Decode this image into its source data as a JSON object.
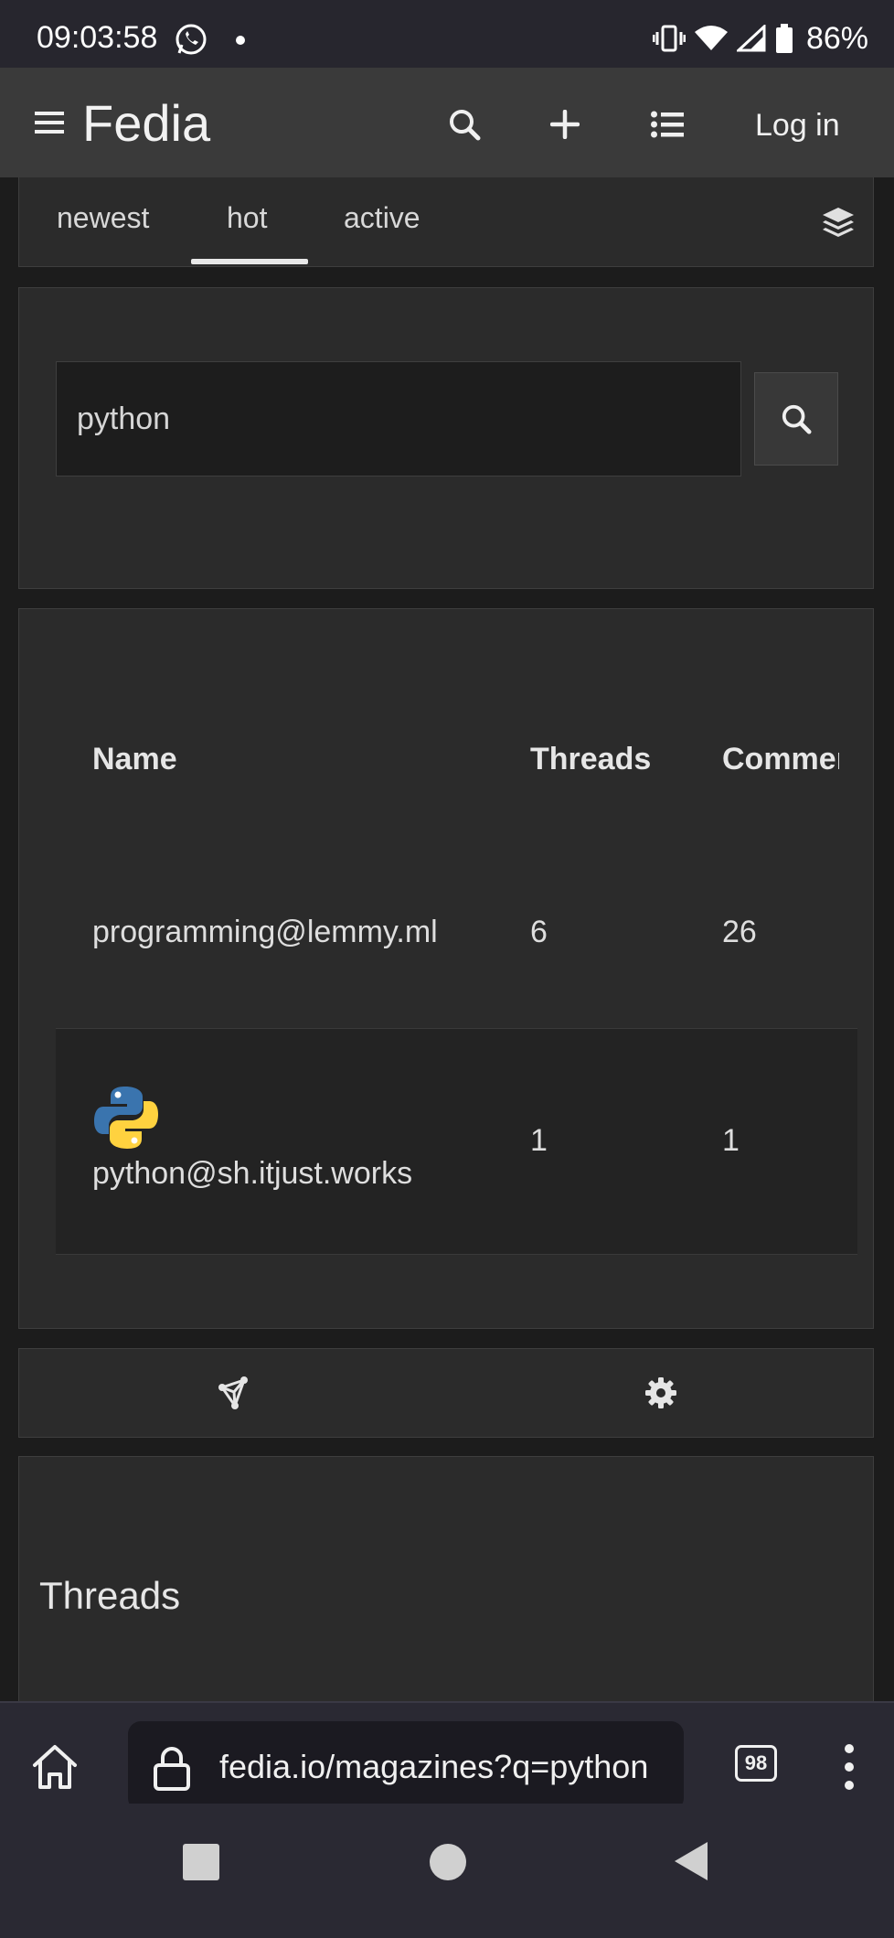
{
  "status_bar": {
    "time": "09:03:58",
    "battery": "86%"
  },
  "header": {
    "brand": "Fedia",
    "login_label": "Log in"
  },
  "sort_tabs": [
    {
      "label": "newest",
      "active": false
    },
    {
      "label": "hot",
      "active": true
    },
    {
      "label": "active",
      "active": false
    }
  ],
  "search": {
    "value": "python"
  },
  "results_table": {
    "columns": [
      "Name",
      "Threads",
      "Comments"
    ],
    "rows": [
      {
        "name": "programming@lemmy.ml",
        "threads": "6",
        "comments": "26",
        "has_icon": false
      },
      {
        "name": "python@sh.itjust.works",
        "threads": "1",
        "comments": "1",
        "has_icon": true
      }
    ]
  },
  "threads_section": {
    "title": "Threads"
  },
  "browser": {
    "url": "fedia.io/magazines?q=python",
    "tab_count": "98"
  },
  "icons": {
    "menu": "hamburger-icon",
    "search": "search-icon",
    "add": "plus-icon",
    "list": "list-icon",
    "layers": "layers-icon",
    "federation": "fediverse-icon",
    "settings": "gear-icon"
  },
  "colors": {
    "background": "#1c1c1c",
    "panel": "#2b2b2b",
    "header": "#3a3a3a",
    "text": "#e6e6e6"
  }
}
